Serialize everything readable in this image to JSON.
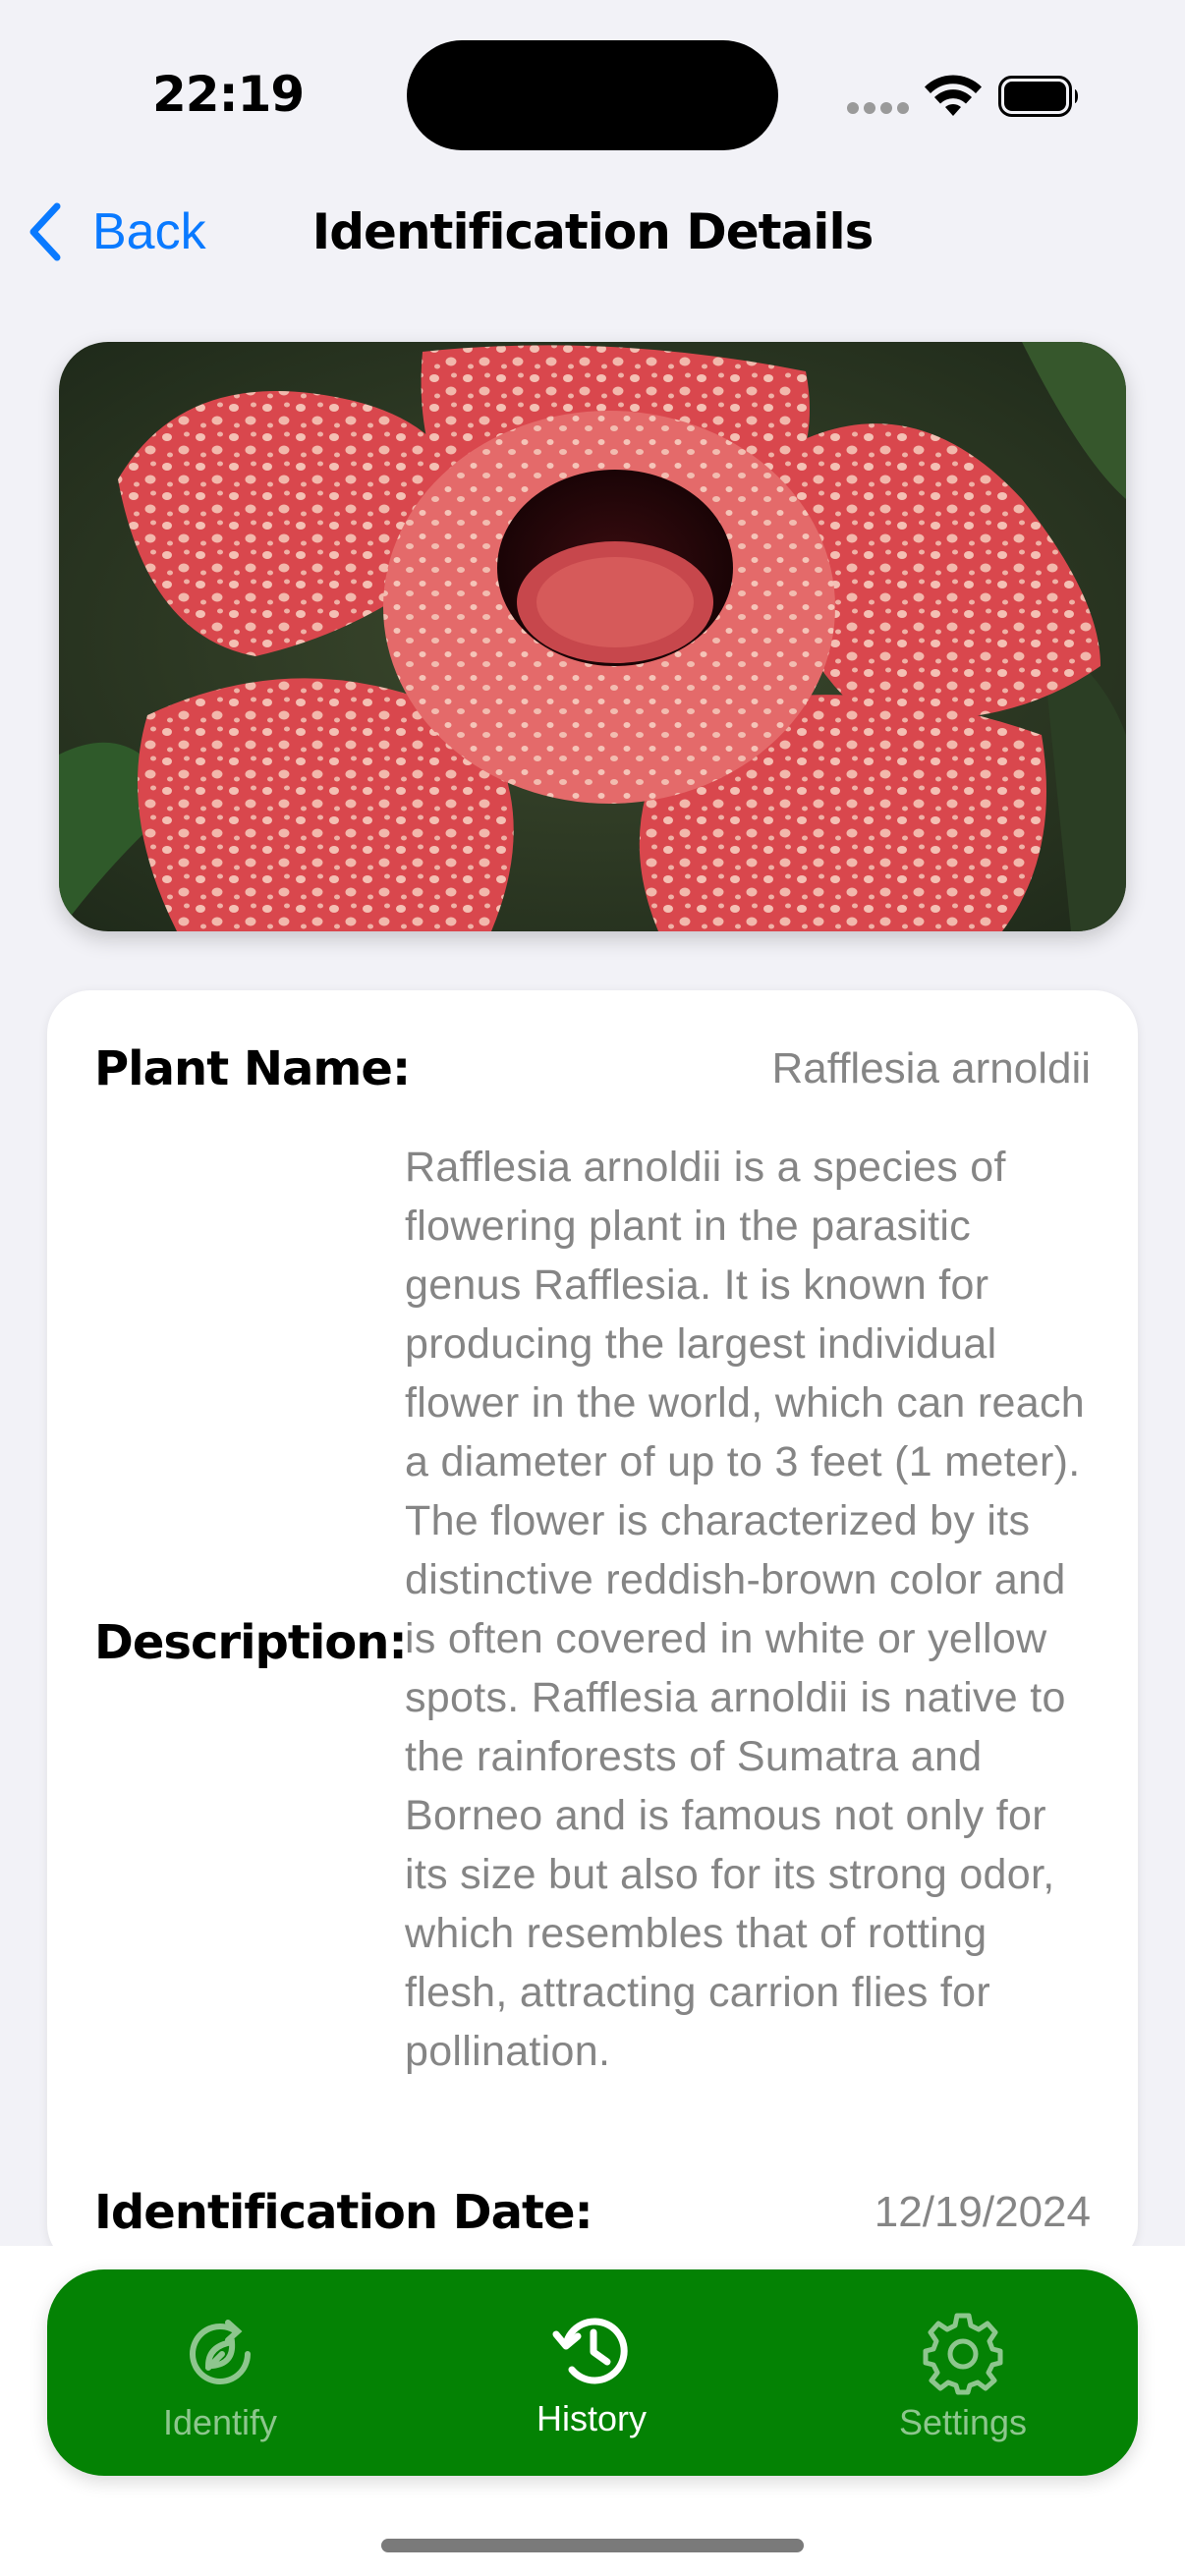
{
  "status_bar": {
    "time": "22:19"
  },
  "nav": {
    "back_label": "Back",
    "title": "Identification Details"
  },
  "plant_image": {
    "subject": "Rafflesia flower photo"
  },
  "details": {
    "name_label": "Plant Name:",
    "name_value": "Rafflesia arnoldii",
    "description_label": "Description:",
    "description_value": "Rafflesia arnoldii is a species of flowering plant in the parasitic genus Rafflesia. It is known for producing the largest individual flower in the world, which can reach a diameter of up to 3 feet (1 meter). The flower is characterized by its distinctive reddish-brown color and is often covered in white or yellow spots. Rafflesia arnoldii is native to the rainforests of Sumatra and Borneo and is famous not only for its size but also for its strong odor, which resembles that of rotting flesh, attracting carrion flies for pollination.",
    "date_label": "Identification Date:",
    "date_value": "12/19/2024"
  },
  "tabs": [
    {
      "label": "Identify",
      "icon": "identify-icon",
      "active": false
    },
    {
      "label": "History",
      "icon": "history-icon",
      "active": true
    },
    {
      "label": "Settings",
      "icon": "gear-icon",
      "active": false
    }
  ],
  "colors": {
    "accent": "#0A7AFF",
    "tab_bar": "#048204",
    "background": "#F2F2F7",
    "secondary_text": "#858585"
  }
}
